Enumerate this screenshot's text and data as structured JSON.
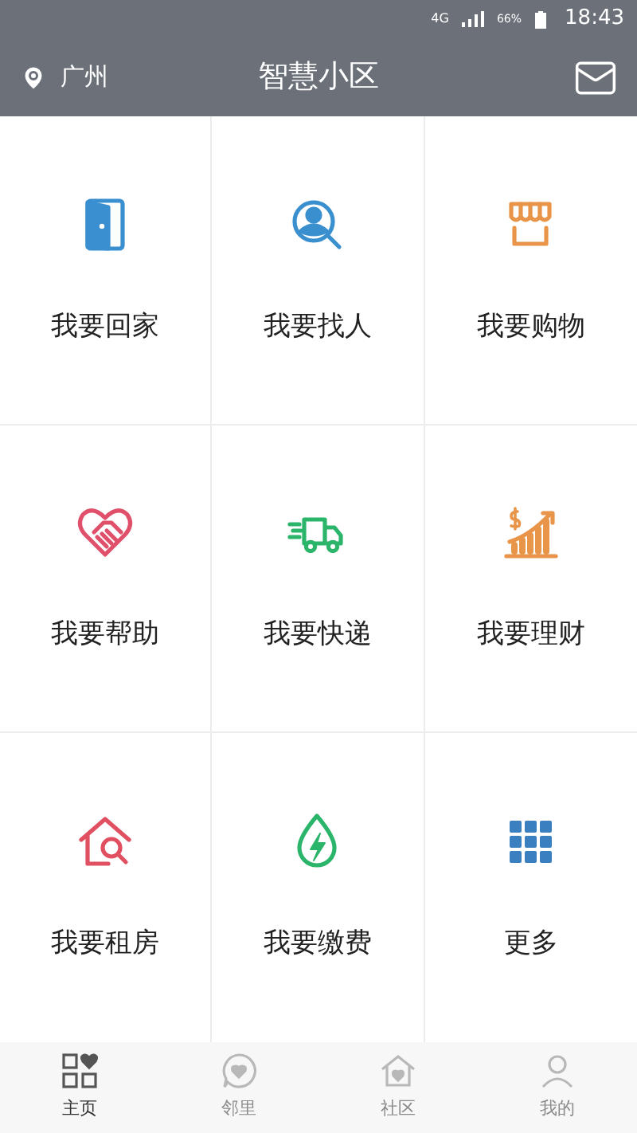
{
  "status_bar": {
    "network": "4G",
    "battery": "66%",
    "time": "18:43"
  },
  "header": {
    "location": "广州",
    "title": "智慧小区"
  },
  "grid": [
    {
      "label": "我要回家"
    },
    {
      "label": "我要找人"
    },
    {
      "label": "我要购物"
    },
    {
      "label": "我要帮助"
    },
    {
      "label": "我要快递"
    },
    {
      "label": "我要理财"
    },
    {
      "label": "我要租房"
    },
    {
      "label": "我要缴费"
    },
    {
      "label": "更多"
    }
  ],
  "tab_bar": [
    {
      "label": "主页",
      "selected": true
    },
    {
      "label": "邻里",
      "selected": false
    },
    {
      "label": "社区",
      "selected": false
    },
    {
      "label": "我的",
      "selected": false
    }
  ]
}
